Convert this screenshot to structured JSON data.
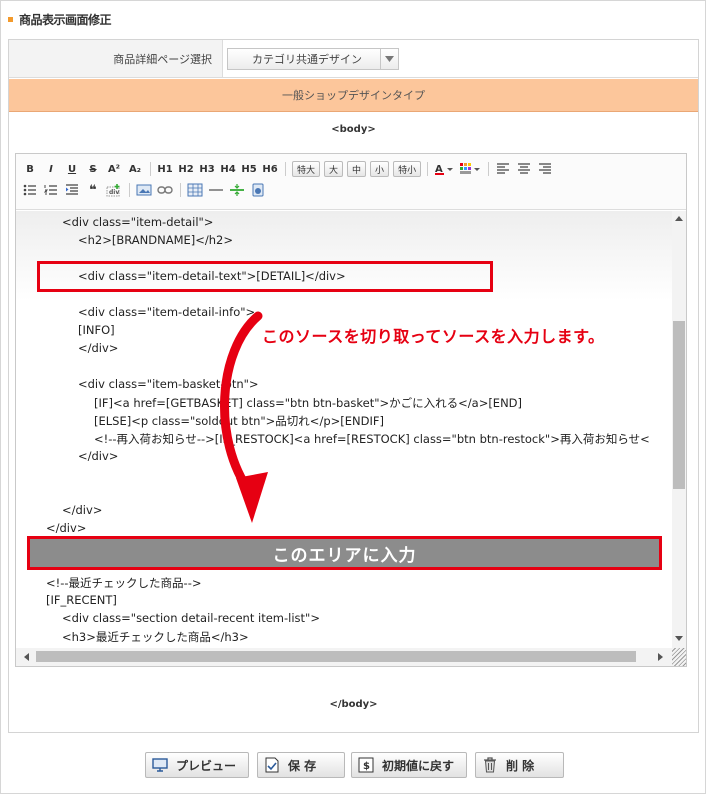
{
  "header": {
    "title": "商品表示画面修正"
  },
  "selector": {
    "label": "商品詳細ページ選択",
    "value": "カテゴリ共通デザイン"
  },
  "design_type": "一般ショップデザインタイプ",
  "tags": {
    "open": "<body>",
    "close": "</body>"
  },
  "toolbar": {
    "row1": [
      "B",
      "I",
      "U",
      "S",
      "A²",
      "A₂",
      "H1",
      "H2",
      "H3",
      "H4",
      "H5",
      "H6"
    ],
    "sizes": [
      "特大",
      "大",
      "中",
      "小",
      "特小"
    ]
  },
  "code_lines": [
    "<div class=\"item-detail\">",
    "<h2>[BRANDNAME]</h2>",
    "<div class=\"item-detail-text\">[DETAIL]</div>",
    "<div class=\"item-detail-info\">",
    "[INFO]",
    "</div>",
    "<div class=\"item-basket-btn\">",
    "[IF]<a href=[GETBASKET] class=\"btn btn-basket\">かごに入れる</a>[END]",
    "[ELSE]<p class=\"soldout btn\">品切れ</p>[ENDIF]",
    "<!--再入荷お知らせ-->[IF_RESTOCK]<a href=[RESTOCK] class=\"btn btn-restock\">再入荷お知らせ<",
    "</div>",
    "</div>",
    "</div>",
    "<!--最近チェックした商品-->",
    "[IF_RECENT]",
    "<div class=\"section detail-recent item-list\">",
    "<h3>最近チェックした商品</h3>"
  ],
  "annotations": {
    "note": "このソースを切り取ってソースを入力します。",
    "area": "このエリアに入力"
  },
  "buttons": {
    "preview": "プレビュー",
    "save": "保 存",
    "reset": "初期値に戻す",
    "delete": "削 除"
  }
}
